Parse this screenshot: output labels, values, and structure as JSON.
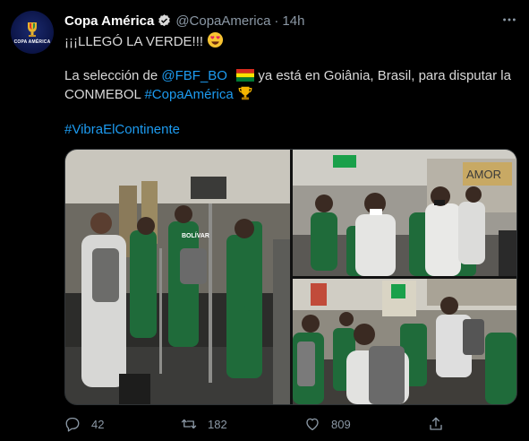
{
  "account": {
    "name": "Copa América",
    "handle": "@CopaAmerica",
    "separator": "·",
    "time": "14h",
    "avatar_text": "COPA AMÉRICA"
  },
  "tweet": {
    "line1": "¡¡¡LLEGÓ LA VERDE!!!",
    "line2_pre": "La selección de ",
    "mention": "@FBF_BO",
    "line2_post": " ya está en Goiânia, Brasil, para disputar la",
    "line3_pre": "CONMEBOL ",
    "hashtag1": "#CopaAmérica",
    "hashtag2": "#VibraElContinente"
  },
  "photos": {
    "sign_amor": "AMOR",
    "shirt_text": "BOLÍVAR"
  },
  "actions": {
    "replies": "42",
    "retweets": "182",
    "likes": "809"
  },
  "colors": {
    "background": "#000000",
    "link": "#1d9bf0",
    "muted": "#8b98a5",
    "jersey_green": "#1f6b3a"
  },
  "icons": [
    "more-icon",
    "verified-icon",
    "heart-eyes-emoji",
    "bolivia-flag-emoji",
    "trophy-emoji",
    "reply-icon",
    "retweet-icon",
    "like-icon",
    "share-icon"
  ]
}
